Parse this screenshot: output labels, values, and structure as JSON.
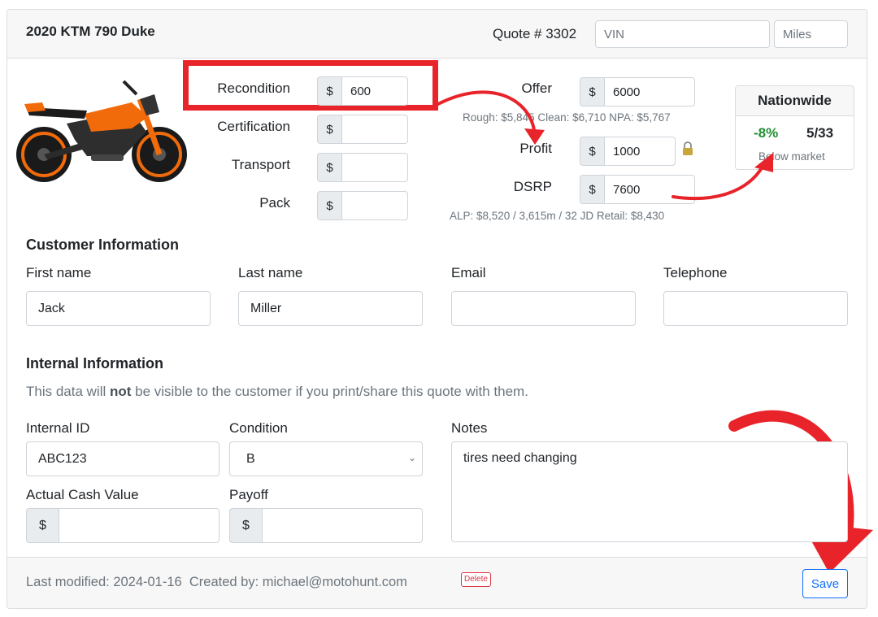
{
  "header": {
    "vehicle_title": "2020 KTM 790 Duke",
    "quote_label": "Quote # 3302",
    "vin_placeholder": "VIN",
    "miles_placeholder": "Miles"
  },
  "image": {
    "alt": "Orange KTM 790 Duke motorcycle",
    "accent_color": "#f26b0a"
  },
  "costs": {
    "recondition": {
      "label": "Recondition",
      "prefix": "$",
      "value": "600"
    },
    "certification": {
      "label": "Certification",
      "prefix": "$",
      "value": ""
    },
    "transport": {
      "label": "Transport",
      "prefix": "$",
      "value": ""
    },
    "pack": {
      "label": "Pack",
      "prefix": "$",
      "value": ""
    }
  },
  "pricing": {
    "offer": {
      "label": "Offer",
      "prefix": "$",
      "value": "6000"
    },
    "offer_note": "Rough: $5,845 Clean: $6,710 NPA: $5,767",
    "profit": {
      "label": "Profit",
      "prefix": "$",
      "value": "1000"
    },
    "dsrp": {
      "label": "DSRP",
      "prefix": "$",
      "value": "7600"
    },
    "dsrp_note": "ALP: $8,520 / 3,615m / 32  JD Retail: $8,430"
  },
  "nationwide": {
    "title": "Nationwide",
    "percent": "-8%",
    "rank": "5/33",
    "status": "Below market",
    "percent_color": "#1e8f2e"
  },
  "customer": {
    "section_title": "Customer Information",
    "first_name": {
      "label": "First name",
      "value": "Jack"
    },
    "last_name": {
      "label": "Last name",
      "value": "Miller"
    },
    "email": {
      "label": "Email",
      "value": ""
    },
    "telephone": {
      "label": "Telephone",
      "value": ""
    }
  },
  "internal": {
    "section_title": "Internal Information",
    "note_prefix": "This data will ",
    "note_bold": "not",
    "note_suffix": " be visible to the customer if you print/share this quote with them.",
    "internal_id": {
      "label": "Internal ID",
      "value": "ABC123"
    },
    "condition": {
      "label": "Condition",
      "value": "B"
    },
    "notes": {
      "label": "Notes",
      "value": "tires need changing"
    },
    "acv": {
      "label": "Actual Cash Value",
      "prefix": "$",
      "value": ""
    },
    "payoff": {
      "label": "Payoff",
      "prefix": "$",
      "value": ""
    }
  },
  "footer": {
    "last_modified": "Last modified: 2024-01-16",
    "created_by": "Created by: michael@motohunt.com",
    "delete_label": "Delete",
    "save_label": "Save"
  },
  "annotations": {
    "highlight_color": "#e8232a"
  }
}
